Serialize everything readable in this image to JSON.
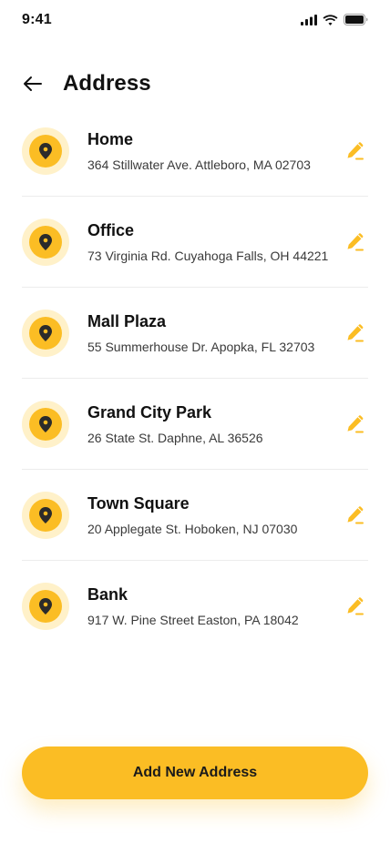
{
  "status_bar": {
    "time": "9:41"
  },
  "header": {
    "title": "Address"
  },
  "addresses": [
    {
      "name": "Home",
      "address": "364 Stillwater Ave. Attleboro, MA 02703"
    },
    {
      "name": "Office",
      "address": "73 Virginia Rd. Cuyahoga Falls, OH 44221"
    },
    {
      "name": "Mall Plaza",
      "address": "55 Summerhouse Dr. Apopka, FL 32703"
    },
    {
      "name": "Grand City Park",
      "address": "26 State St. Daphne, AL 36526"
    },
    {
      "name": "Town Square",
      "address": "20 Applegate St. Hoboken, NJ 07030"
    },
    {
      "name": "Bank",
      "address": "917 W. Pine Street Easton, PA 18042"
    }
  ],
  "actions": {
    "add_label": "Add New Address"
  },
  "icons": {
    "pin": "location-pin-icon",
    "edit": "pencil-edit-icon",
    "back": "arrow-left-icon"
  },
  "colors": {
    "accent": "#fbbd24",
    "accent_light": "#fff1c9",
    "text": "#111111"
  }
}
